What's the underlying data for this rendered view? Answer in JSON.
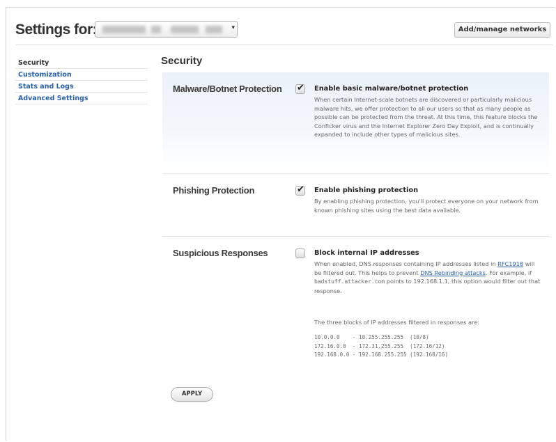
{
  "header": {
    "title": "Settings for:",
    "add_button": "Add/manage networks"
  },
  "sidebar": {
    "items": [
      {
        "label": "Security"
      },
      {
        "label": "Customization"
      },
      {
        "label": "Stats and Logs"
      },
      {
        "label": "Advanced Settings"
      }
    ]
  },
  "main": {
    "section_title": "Security",
    "malware": {
      "label": "Malware/Botnet Protection",
      "checked": true,
      "option_title": "Enable basic malware/botnet protection",
      "description": "When certain Internet-scale botnets are discovered or particularly malicious malware hits, we offer protection to all our users so that as many people as possible can be protected from the threat. At this time, this feature blocks the Conficker virus and the Internet Explorer Zero Day Exploit, and is continually expanded to include other types of malicious sites."
    },
    "phishing": {
      "label": "Phishing Protection",
      "checked": true,
      "option_title": "Enable phishing protection",
      "description": "By enabling phishing protection, you'll protect everyone on your network from known phishing sites using the best data available."
    },
    "suspicious": {
      "label": "Suspicious Responses",
      "checked": false,
      "option_title": "Block internal IP addresses",
      "desc_part1": "When enabled, DNS responses containing IP addresses listed in ",
      "rfc_link": "RFC1918",
      "desc_part2": " will be filtered out. This helps to prevent ",
      "dns_link": "DNS Rebinding attacks",
      "desc_part3": ". For example, if ",
      "example_host": "badstuff.attacker.com",
      "desc_part4": " points to 192.168.1.1, this option would filter out that response.",
      "blocks_intro": "The three blocks of IP addresses filtered in responses are:",
      "ip_blocks": [
        "10.0.0.0    - 10.255.255.255  (10/8)",
        "172.16.0.0  - 172.31.255.255  (172.16/12)",
        "192.168.0.0 - 192.168.255.255 (192.168/16)"
      ]
    },
    "apply_button": "APPLY"
  },
  "icons": {
    "checkbox_tick": "check-icon",
    "select_caret": "chevron-down-icon"
  }
}
